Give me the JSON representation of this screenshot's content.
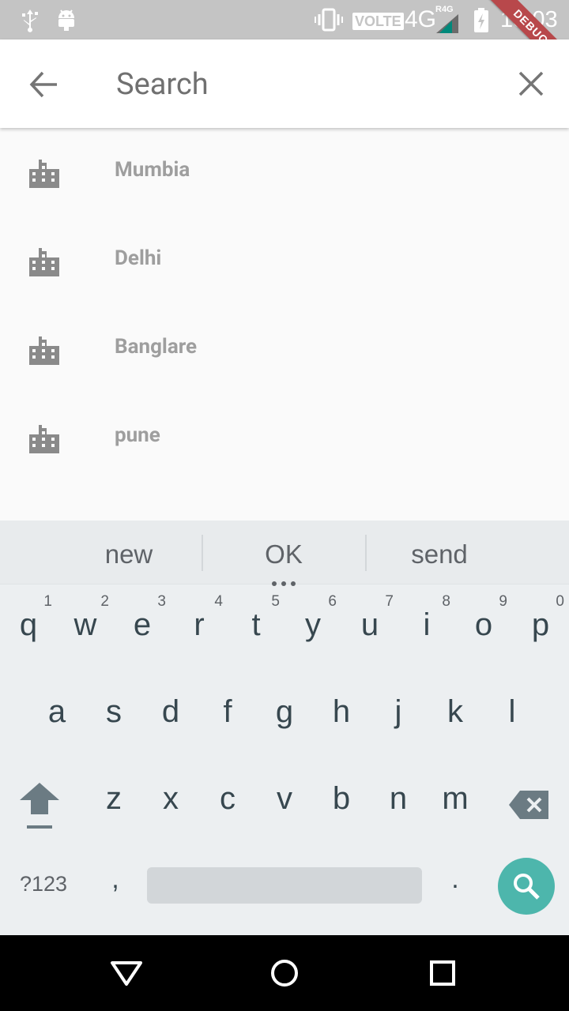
{
  "status_bar": {
    "time": "13:03",
    "volte": "VOLTE",
    "network": "4G",
    "network_sup": "R4G",
    "icons": [
      "usb-icon",
      "android-debug-icon",
      "vibrate-icon",
      "signal-icon",
      "battery-charging-icon"
    ]
  },
  "debug_banner": "DEBUG",
  "app_bar": {
    "search_placeholder": "Search",
    "back_icon": "arrow-back-icon",
    "clear_icon": "close-icon"
  },
  "results": [
    {
      "label": "Mumbia",
      "icon": "location-city-icon"
    },
    {
      "label": "Delhi",
      "icon": "location-city-icon"
    },
    {
      "label": "Banglare",
      "icon": "location-city-icon"
    },
    {
      "label": "pune",
      "icon": "location-city-icon"
    }
  ],
  "keyboard": {
    "suggestions": [
      "new",
      "OK",
      "send"
    ],
    "row1": [
      {
        "ch": "q",
        "hint": "1"
      },
      {
        "ch": "w",
        "hint": "2"
      },
      {
        "ch": "e",
        "hint": "3"
      },
      {
        "ch": "r",
        "hint": "4"
      },
      {
        "ch": "t",
        "hint": "5"
      },
      {
        "ch": "y",
        "hint": "6"
      },
      {
        "ch": "u",
        "hint": "7"
      },
      {
        "ch": "i",
        "hint": "8"
      },
      {
        "ch": "o",
        "hint": "9"
      },
      {
        "ch": "p",
        "hint": "0"
      }
    ],
    "row2": [
      "a",
      "s",
      "d",
      "f",
      "g",
      "h",
      "j",
      "k",
      "l"
    ],
    "row3": [
      "z",
      "x",
      "c",
      "v",
      "b",
      "n",
      "m"
    ],
    "symbols_label": "?123",
    "comma": ",",
    "period": ".",
    "accent_color": "#4db6ac"
  },
  "nav_bar": {
    "icons": [
      "back-triangle-icon",
      "home-circle-icon",
      "recents-square-icon"
    ]
  }
}
